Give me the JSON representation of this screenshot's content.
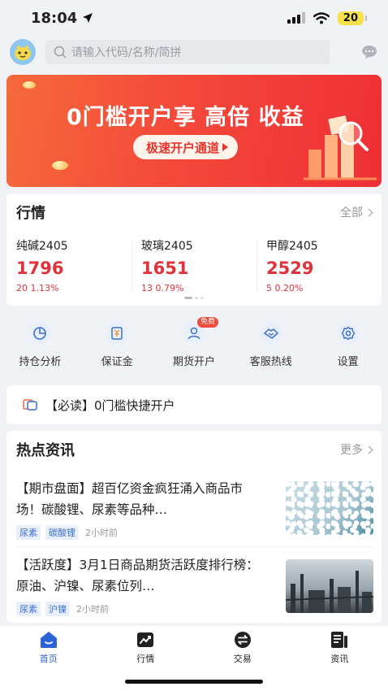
{
  "status_bar": {
    "time": "18:04",
    "battery": "20"
  },
  "search": {
    "placeholder": "请输入代码/名称/简拼"
  },
  "banner": {
    "title": "0门槛开户享 高倍 收益",
    "cta": "极速开户通道"
  },
  "market": {
    "title": "行情",
    "more": "全部",
    "quotes": [
      {
        "name": "纯碱2405",
        "price": "1796",
        "change": "20  1.13%"
      },
      {
        "name": "玻璃2405",
        "price": "1651",
        "change": "13  0.79%"
      },
      {
        "name": "甲醇2405",
        "price": "2529",
        "change": "5  0.20%"
      }
    ]
  },
  "shortcuts": [
    {
      "label": "持仓分析",
      "icon": "pie-chart-icon"
    },
    {
      "label": "保证金",
      "icon": "yuan-doc-icon"
    },
    {
      "label": "期货开户",
      "icon": "user-add-icon",
      "badge": "免费"
    },
    {
      "label": "客服热线",
      "icon": "handshake-icon"
    },
    {
      "label": "设置",
      "icon": "gear-icon"
    }
  ],
  "notice": {
    "text": "【必读】0门槛快捷开户"
  },
  "news": {
    "title": "热点资讯",
    "more": "更多",
    "items": [
      {
        "title": "【期市盘面】超百亿资金疯狂涌入商品市场！碳酸锂、尿素等品种…",
        "tags": [
          "尿素",
          "碳酸锂"
        ],
        "ago": "2小时前"
      },
      {
        "title": "【活跃度】3月1日商品期货活跃度排行榜：原油、沪镍、尿素位列…",
        "tags": [
          "尿素",
          "沪镍"
        ],
        "ago": "2小时前"
      }
    ]
  },
  "tabbar": [
    {
      "label": "首页",
      "icon": "home-icon",
      "active": true
    },
    {
      "label": "行情",
      "icon": "trend-chart-icon"
    },
    {
      "label": "交易",
      "icon": "exchange-icon"
    },
    {
      "label": "资讯",
      "icon": "news-icon"
    }
  ],
  "colors": {
    "accent": "#2d63d8",
    "up": "#e0323a",
    "banner": "#f4493a"
  }
}
